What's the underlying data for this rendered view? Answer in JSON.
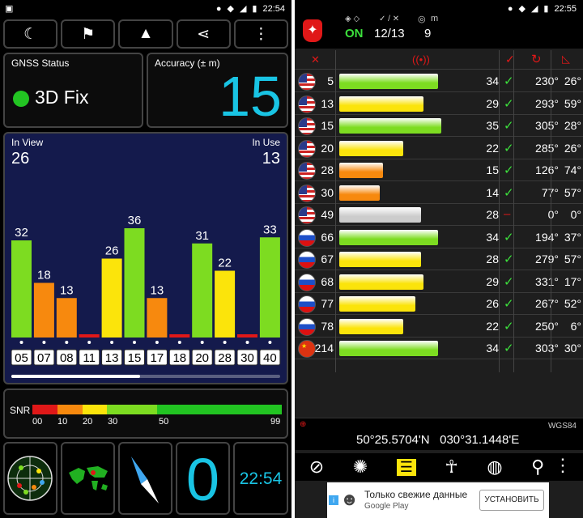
{
  "left": {
    "status_time": "22:54",
    "toolbar": [
      "☾",
      "⚑",
      "▲",
      "⋖",
      "⋮"
    ],
    "gnss_label": "GNSS Status",
    "fix_text": "3D Fix",
    "accuracy_label": "Accuracy (± m)",
    "accuracy_value": "15",
    "in_view_label": "In View",
    "in_view_value": "26",
    "in_use_label": "In Use",
    "in_use_value": "13",
    "snr_label": "SNR",
    "snr_ticks": [
      "00",
      "10",
      "20",
      "30",
      "50",
      "99"
    ],
    "bottom_zero": "0",
    "bottom_time": "22:54",
    "colors": {
      "green": "#7ddc21",
      "yellow": "#fbe40b",
      "orange": "#f7890e",
      "red": "#e01818",
      "accent": "#19c4e4"
    }
  },
  "chart_data": {
    "type": "bar",
    "categories": [
      "05",
      "07",
      "08",
      "11",
      "13",
      "15",
      "17",
      "18",
      "20",
      "28",
      "30",
      "40"
    ],
    "values": [
      32,
      18,
      13,
      0,
      26,
      36,
      13,
      0,
      31,
      22,
      0,
      33
    ],
    "value_labels": [
      "32",
      "18",
      "13",
      "",
      "26",
      "36",
      "13",
      "",
      "31",
      "22",
      "",
      "33"
    ],
    "colors": [
      "#7ddc21",
      "#f7890e",
      "#f7890e",
      "#e01818",
      "#fbe40b",
      "#7ddc21",
      "#f7890e",
      "#e01818",
      "#7ddc21",
      "#fbe40b",
      "#e01818",
      "#7ddc21"
    ],
    "ylim": [
      0,
      40
    ],
    "title": "",
    "xlabel": "",
    "ylabel": ""
  },
  "right": {
    "status_time": "22:55",
    "header_status": "ON",
    "header_count": "12/13",
    "header_nine": "9",
    "header_m": "m",
    "rows": [
      {
        "flag": "us",
        "num": "5",
        "snr": "34",
        "snr_val": 34,
        "az": "230°",
        "el": "26°",
        "color": "#7ddc21",
        "check": "✓"
      },
      {
        "flag": "us",
        "num": "13",
        "snr": "29",
        "snr_val": 29,
        "az": "293°",
        "el": "59°",
        "color": "#fbe40b",
        "check": "✓"
      },
      {
        "flag": "us",
        "num": "15",
        "snr": "35",
        "snr_val": 35,
        "az": "305°",
        "el": "28°",
        "color": "#7ddc21",
        "check": "✓"
      },
      {
        "flag": "us",
        "num": "20",
        "snr": "22",
        "snr_val": 22,
        "az": "285°",
        "el": "26°",
        "color": "#fbe40b",
        "check": "✓"
      },
      {
        "flag": "us",
        "num": "28",
        "snr": "15",
        "snr_val": 15,
        "az": "126°",
        "el": "74°",
        "color": "#f7890e",
        "check": "✓"
      },
      {
        "flag": "us",
        "num": "30",
        "snr": "14",
        "snr_val": 14,
        "az": "77°",
        "el": "57°",
        "color": "#f7890e",
        "check": "✓"
      },
      {
        "flag": "us",
        "num": "49",
        "snr": "28",
        "snr_val": 28,
        "az": "0°",
        "el": "0°",
        "color": "#cccccc",
        "check": "–"
      },
      {
        "flag": "ru",
        "num": "66",
        "snr": "34",
        "snr_val": 34,
        "az": "194°",
        "el": "37°",
        "color": "#7ddc21",
        "check": "✓"
      },
      {
        "flag": "ru",
        "num": "67",
        "snr": "28",
        "snr_val": 28,
        "az": "279°",
        "el": "57°",
        "color": "#fbe40b",
        "check": "✓"
      },
      {
        "flag": "ru",
        "num": "68",
        "snr": "29",
        "snr_val": 29,
        "az": "331°",
        "el": "17°",
        "color": "#fbe40b",
        "check": "✓"
      },
      {
        "flag": "ru",
        "num": "77",
        "snr": "26",
        "snr_val": 26,
        "az": "267°",
        "el": "52°",
        "color": "#fbe40b",
        "check": "✓"
      },
      {
        "flag": "ru",
        "num": "78",
        "snr": "22",
        "snr_val": 22,
        "az": "250°",
        "el": "6°",
        "color": "#fbe40b",
        "check": "✓"
      },
      {
        "flag": "cn",
        "num": "214",
        "snr": "34",
        "snr_val": 34,
        "az": "303°",
        "el": "30°",
        "color": "#7ddc21",
        "check": "✓"
      }
    ],
    "datum": "WGS84",
    "coords": "50°25.5704'N   030°31.1448'E",
    "ad_text": "Только свежие данные",
    "ad_source": "Google Play",
    "ad_button": "УСТАНОВИТЬ"
  }
}
